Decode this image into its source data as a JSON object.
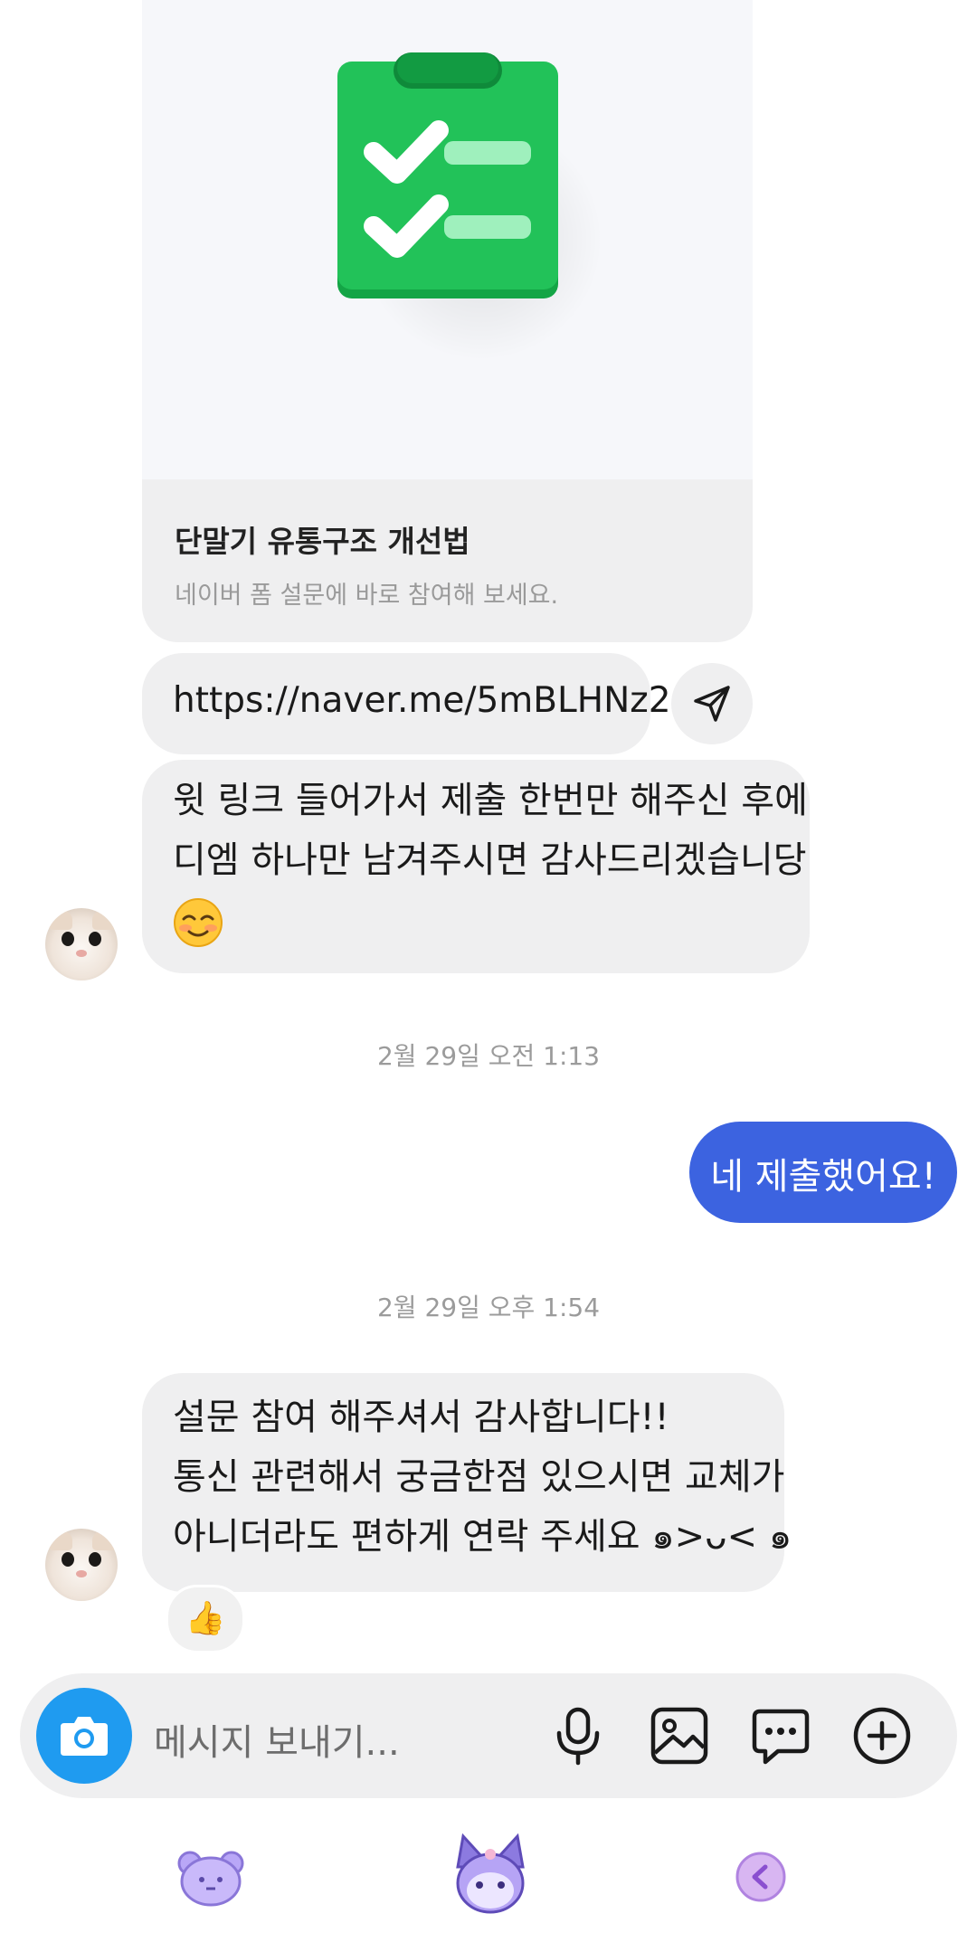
{
  "link_card": {
    "title": "단말기 유통구조 개선법",
    "description": "네이버 폼 설문에 바로 참여해 보세요.",
    "image_icon": "clipboard-checklist-icon"
  },
  "link_message": {
    "url": "https://naver.me/5mBLHNz2",
    "share_icon": "send-icon"
  },
  "received_message_1": {
    "lines": [
      "윗 링크 들어가서 제출 한번만 해주신 후에",
      "디엠 하나만 남겨주시면 감사드리겠습니당"
    ],
    "emoji": "☺️"
  },
  "timestamp_1": "2월 29일 오전 1:13",
  "sent_message": {
    "text": "네 제출했어요!"
  },
  "timestamp_2": "2월 29일 오후 1:54",
  "received_message_2": {
    "lines": [
      "설문 참여 해주셔서 감사합니다!!",
      "통신 관련해서 궁금한점 있으시면 교체가",
      "아니더라도 편하게 연락 주세요 ๑>ᴗ< ๑"
    ],
    "reaction": "👍"
  },
  "composer": {
    "placeholder": "메시지 보내기...",
    "icons": [
      "camera-icon",
      "microphone-icon",
      "image-icon",
      "sticker-chat-icon",
      "plus-circle-icon"
    ]
  },
  "colors": {
    "sent_bubble": "#3c63e0",
    "received_bubble": "#efeff0",
    "camera_button": "#1f9bf0",
    "nav_accent": "#b9a7f7"
  },
  "bottom_nav": [
    "bear-icon",
    "kuromi-icon",
    "back-icon"
  ]
}
